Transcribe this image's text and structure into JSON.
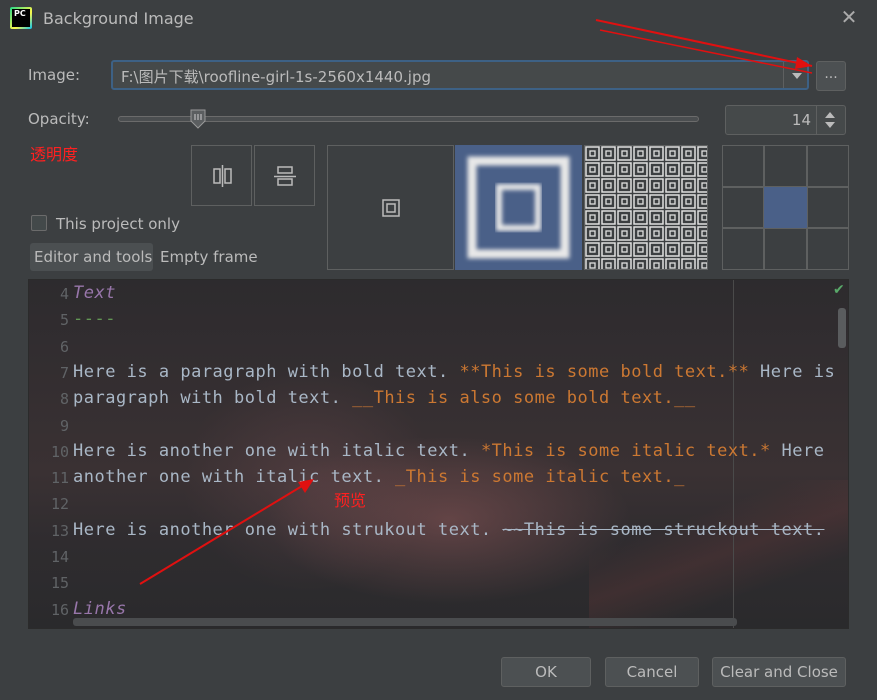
{
  "window": {
    "title": "Background Image",
    "close_glyph": "✕"
  },
  "image": {
    "label": "Image:",
    "path": "F:\\图片下载\\roofline-girl-1s-2560x1440.jpg",
    "browse_label": "..."
  },
  "opacity": {
    "label": "Opacity:",
    "value": "14",
    "fraction": 0.14
  },
  "annotations": {
    "opacity_cn": "透明度",
    "preview_cn": "预览",
    "color": "#ff2020"
  },
  "checkbox": {
    "label": "This project only",
    "checked": false
  },
  "target": {
    "selected": "Editor and tools",
    "other": "Empty frame"
  },
  "editor": {
    "lines": [
      {
        "num": "4",
        "type": "kw",
        "text": "Text"
      },
      {
        "num": "5",
        "type": "sep",
        "text": "----"
      },
      {
        "num": "6",
        "type": "plain",
        "text": ""
      },
      {
        "num": "7",
        "type": "mixed",
        "a": "Here is a paragraph with bold text. ",
        "b": "**This is some bold text.**",
        "c": " Here is"
      },
      {
        "num": "8",
        "type": "mixed",
        "a": "paragraph with bold text. ",
        "b": "__This is also some bold text.__",
        "c": ""
      },
      {
        "num": "9",
        "type": "plain",
        "text": ""
      },
      {
        "num": "10",
        "type": "mixed",
        "a": "Here is another one with italic text. ",
        "b": "*This is some italic text.*",
        "c": " Here"
      },
      {
        "num": "11",
        "type": "mixed",
        "a": "another one with italic text. ",
        "b": "_This is some italic text._",
        "c": ""
      },
      {
        "num": "12",
        "type": "plain",
        "text": ""
      },
      {
        "num": "13",
        "type": "strike",
        "a": "Here is another one with strukout text. ",
        "b": "~~This is some struckout text."
      },
      {
        "num": "14",
        "type": "plain",
        "text": ""
      },
      {
        "num": "15",
        "type": "plain",
        "text": ""
      },
      {
        "num": "16",
        "type": "kw",
        "text": "Links"
      }
    ]
  },
  "buttons": {
    "ok": "OK",
    "cancel": "Cancel",
    "clear": "Clear and Close"
  },
  "colors": {
    "accent": "#3d6185",
    "selected_tile": "#4a6088"
  }
}
